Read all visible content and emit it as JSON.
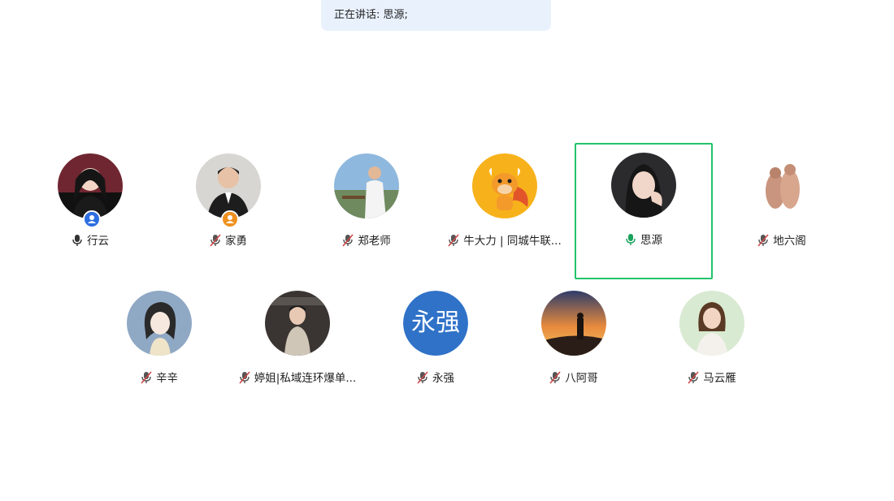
{
  "banner": {
    "text": "正在讲话: 思源;"
  },
  "participants": [
    {
      "name": "行云",
      "mic": "on",
      "badge": "host",
      "avatar": "photo"
    },
    {
      "name": "家勇",
      "mic": "muted",
      "badge": "co-host",
      "avatar": "photo"
    },
    {
      "name": "郑老师",
      "mic": "muted",
      "avatar": "photo"
    },
    {
      "name": "牛大力 | 同城牛联...",
      "mic": "muted",
      "avatar": "cartoon-bull"
    },
    {
      "name": "思源",
      "mic": "speaking",
      "active": true,
      "avatar": "photo"
    },
    {
      "name": "地六阁",
      "mic": "muted",
      "avatar": "cartoon"
    },
    {
      "name": "辛辛",
      "mic": "muted",
      "avatar": "illustration"
    },
    {
      "name": "婷姐|私域连环爆单...",
      "mic": "muted",
      "avatar": "photo"
    },
    {
      "name": "永强",
      "mic": "muted",
      "avatar": "text",
      "avatar_text": "永强"
    },
    {
      "name": "八阿哥",
      "mic": "muted",
      "avatar": "photo"
    },
    {
      "name": "马云雁",
      "mic": "muted",
      "avatar": "photo"
    }
  ],
  "colors": {
    "active_border": "#22c36b",
    "speaking_mic": "#1aa35c",
    "muted_mic": "#d04848",
    "host_badge": "#2d6fe0",
    "cohost_badge": "#f0901e",
    "banner_bg": "#e9f1fd",
    "text_avatar_bg": "#2f72c8"
  },
  "icons": {
    "mic_on": "microphone-icon",
    "mic_muted": "microphone-muted-icon",
    "host": "user-badge-icon"
  }
}
